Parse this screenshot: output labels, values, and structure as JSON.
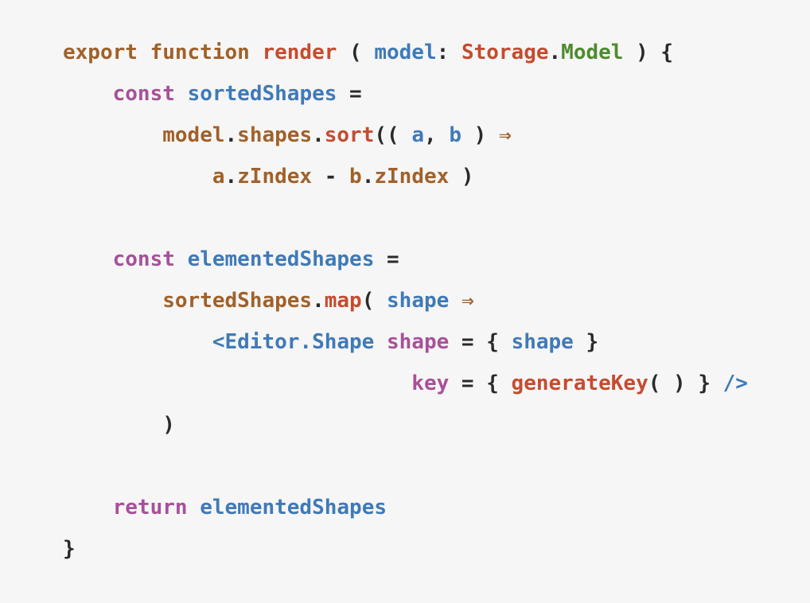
{
  "code": {
    "lines": [
      [
        {
          "text": "export function ",
          "kind": "export-function"
        },
        {
          "text": "render",
          "kind": "fn-name"
        },
        {
          "text": " ( ",
          "kind": "plain"
        },
        {
          "text": "model",
          "kind": "param"
        },
        {
          "text": ": ",
          "kind": "plain"
        },
        {
          "text": "Storage",
          "kind": "type"
        },
        {
          "text": ".",
          "kind": "plain"
        },
        {
          "text": "Model",
          "kind": "type-member"
        },
        {
          "text": " ) {",
          "kind": "plain"
        }
      ],
      [
        {
          "text": "    ",
          "kind": "plain"
        },
        {
          "text": "const",
          "kind": "keyword"
        },
        {
          "text": " ",
          "kind": "plain"
        },
        {
          "text": "sortedShapes",
          "kind": "identifier"
        },
        {
          "text": " =",
          "kind": "plain"
        }
      ],
      [
        {
          "text": "        ",
          "kind": "plain"
        },
        {
          "text": "model",
          "kind": "object"
        },
        {
          "text": ".",
          "kind": "plain"
        },
        {
          "text": "shapes",
          "kind": "object"
        },
        {
          "text": ".",
          "kind": "plain"
        },
        {
          "text": "sort",
          "kind": "method"
        },
        {
          "text": "(( ",
          "kind": "plain"
        },
        {
          "text": "a",
          "kind": "param"
        },
        {
          "text": ", ",
          "kind": "plain"
        },
        {
          "text": "b",
          "kind": "param"
        },
        {
          "text": " ) ",
          "kind": "plain"
        },
        {
          "text": "⇒",
          "kind": "arrow"
        }
      ],
      [
        {
          "text": "            ",
          "kind": "plain"
        },
        {
          "text": "a",
          "kind": "object"
        },
        {
          "text": ".",
          "kind": "plain"
        },
        {
          "text": "zIndex",
          "kind": "object"
        },
        {
          "text": " - ",
          "kind": "plain"
        },
        {
          "text": "b",
          "kind": "object"
        },
        {
          "text": ".",
          "kind": "plain"
        },
        {
          "text": "zIndex",
          "kind": "object"
        },
        {
          "text": " )",
          "kind": "plain"
        }
      ],
      [],
      [
        {
          "text": "    ",
          "kind": "plain"
        },
        {
          "text": "const",
          "kind": "keyword"
        },
        {
          "text": " ",
          "kind": "plain"
        },
        {
          "text": "elementedShapes",
          "kind": "identifier"
        },
        {
          "text": " =",
          "kind": "plain"
        }
      ],
      [
        {
          "text": "        ",
          "kind": "plain"
        },
        {
          "text": "sortedShapes",
          "kind": "object"
        },
        {
          "text": ".",
          "kind": "plain"
        },
        {
          "text": "map",
          "kind": "method"
        },
        {
          "text": "( ",
          "kind": "plain"
        },
        {
          "text": "shape",
          "kind": "param"
        },
        {
          "text": " ",
          "kind": "plain"
        },
        {
          "text": "⇒",
          "kind": "arrow"
        }
      ],
      [
        {
          "text": "            ",
          "kind": "plain"
        },
        {
          "text": "<Editor.Shape",
          "kind": "tag"
        },
        {
          "text": " ",
          "kind": "plain"
        },
        {
          "text": "shape",
          "kind": "attr"
        },
        {
          "text": " = { ",
          "kind": "plain"
        },
        {
          "text": "shape",
          "kind": "param"
        },
        {
          "text": " }",
          "kind": "plain"
        }
      ],
      [
        {
          "text": "                            ",
          "kind": "plain"
        },
        {
          "text": "key",
          "kind": "attr"
        },
        {
          "text": " = { ",
          "kind": "plain"
        },
        {
          "text": "generateKey",
          "kind": "call"
        },
        {
          "text": "( ) } ",
          "kind": "plain"
        },
        {
          "text": "/>",
          "kind": "tag"
        }
      ],
      [
        {
          "text": "        )",
          "kind": "plain"
        }
      ],
      [],
      [
        {
          "text": "    ",
          "kind": "plain"
        },
        {
          "text": "return",
          "kind": "keyword"
        },
        {
          "text": " ",
          "kind": "plain"
        },
        {
          "text": "elementedShapes",
          "kind": "identifier"
        }
      ],
      [
        {
          "text": "}",
          "kind": "plain"
        }
      ]
    ]
  }
}
